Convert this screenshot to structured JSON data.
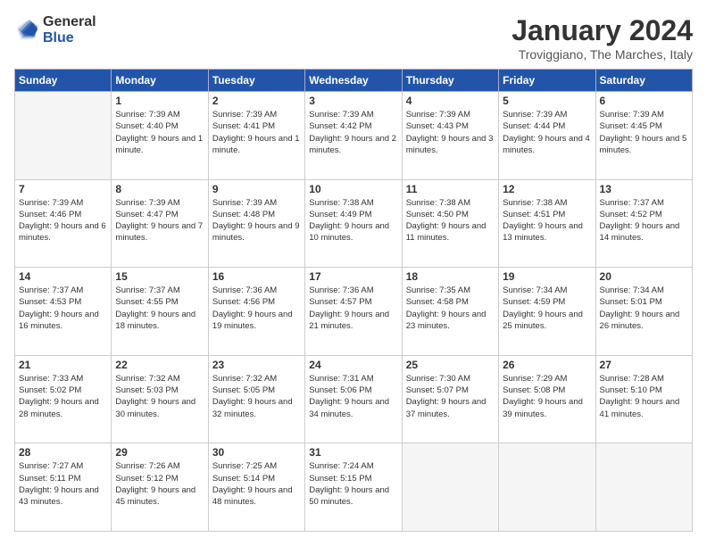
{
  "logo": {
    "general": "General",
    "blue": "Blue"
  },
  "header": {
    "title": "January 2024",
    "subtitle": "Troviggiano, The Marches, Italy"
  },
  "days_of_week": [
    "Sunday",
    "Monday",
    "Tuesday",
    "Wednesday",
    "Thursday",
    "Friday",
    "Saturday"
  ],
  "weeks": [
    [
      {
        "day": "",
        "empty": true
      },
      {
        "day": "1",
        "sunrise": "Sunrise: 7:39 AM",
        "sunset": "Sunset: 4:40 PM",
        "daylight": "Daylight: 9 hours and 1 minute."
      },
      {
        "day": "2",
        "sunrise": "Sunrise: 7:39 AM",
        "sunset": "Sunset: 4:41 PM",
        "daylight": "Daylight: 9 hours and 1 minute."
      },
      {
        "day": "3",
        "sunrise": "Sunrise: 7:39 AM",
        "sunset": "Sunset: 4:42 PM",
        "daylight": "Daylight: 9 hours and 2 minutes."
      },
      {
        "day": "4",
        "sunrise": "Sunrise: 7:39 AM",
        "sunset": "Sunset: 4:43 PM",
        "daylight": "Daylight: 9 hours and 3 minutes."
      },
      {
        "day": "5",
        "sunrise": "Sunrise: 7:39 AM",
        "sunset": "Sunset: 4:44 PM",
        "daylight": "Daylight: 9 hours and 4 minutes."
      },
      {
        "day": "6",
        "sunrise": "Sunrise: 7:39 AM",
        "sunset": "Sunset: 4:45 PM",
        "daylight": "Daylight: 9 hours and 5 minutes."
      }
    ],
    [
      {
        "day": "7",
        "sunrise": "Sunrise: 7:39 AM",
        "sunset": "Sunset: 4:46 PM",
        "daylight": "Daylight: 9 hours and 6 minutes."
      },
      {
        "day": "8",
        "sunrise": "Sunrise: 7:39 AM",
        "sunset": "Sunset: 4:47 PM",
        "daylight": "Daylight: 9 hours and 7 minutes."
      },
      {
        "day": "9",
        "sunrise": "Sunrise: 7:39 AM",
        "sunset": "Sunset: 4:48 PM",
        "daylight": "Daylight: 9 hours and 9 minutes."
      },
      {
        "day": "10",
        "sunrise": "Sunrise: 7:38 AM",
        "sunset": "Sunset: 4:49 PM",
        "daylight": "Daylight: 9 hours and 10 minutes."
      },
      {
        "day": "11",
        "sunrise": "Sunrise: 7:38 AM",
        "sunset": "Sunset: 4:50 PM",
        "daylight": "Daylight: 9 hours and 11 minutes."
      },
      {
        "day": "12",
        "sunrise": "Sunrise: 7:38 AM",
        "sunset": "Sunset: 4:51 PM",
        "daylight": "Daylight: 9 hours and 13 minutes."
      },
      {
        "day": "13",
        "sunrise": "Sunrise: 7:37 AM",
        "sunset": "Sunset: 4:52 PM",
        "daylight": "Daylight: 9 hours and 14 minutes."
      }
    ],
    [
      {
        "day": "14",
        "sunrise": "Sunrise: 7:37 AM",
        "sunset": "Sunset: 4:53 PM",
        "daylight": "Daylight: 9 hours and 16 minutes."
      },
      {
        "day": "15",
        "sunrise": "Sunrise: 7:37 AM",
        "sunset": "Sunset: 4:55 PM",
        "daylight": "Daylight: 9 hours and 18 minutes."
      },
      {
        "day": "16",
        "sunrise": "Sunrise: 7:36 AM",
        "sunset": "Sunset: 4:56 PM",
        "daylight": "Daylight: 9 hours and 19 minutes."
      },
      {
        "day": "17",
        "sunrise": "Sunrise: 7:36 AM",
        "sunset": "Sunset: 4:57 PM",
        "daylight": "Daylight: 9 hours and 21 minutes."
      },
      {
        "day": "18",
        "sunrise": "Sunrise: 7:35 AM",
        "sunset": "Sunset: 4:58 PM",
        "daylight": "Daylight: 9 hours and 23 minutes."
      },
      {
        "day": "19",
        "sunrise": "Sunrise: 7:34 AM",
        "sunset": "Sunset: 4:59 PM",
        "daylight": "Daylight: 9 hours and 25 minutes."
      },
      {
        "day": "20",
        "sunrise": "Sunrise: 7:34 AM",
        "sunset": "Sunset: 5:01 PM",
        "daylight": "Daylight: 9 hours and 26 minutes."
      }
    ],
    [
      {
        "day": "21",
        "sunrise": "Sunrise: 7:33 AM",
        "sunset": "Sunset: 5:02 PM",
        "daylight": "Daylight: 9 hours and 28 minutes."
      },
      {
        "day": "22",
        "sunrise": "Sunrise: 7:32 AM",
        "sunset": "Sunset: 5:03 PM",
        "daylight": "Daylight: 9 hours and 30 minutes."
      },
      {
        "day": "23",
        "sunrise": "Sunrise: 7:32 AM",
        "sunset": "Sunset: 5:05 PM",
        "daylight": "Daylight: 9 hours and 32 minutes."
      },
      {
        "day": "24",
        "sunrise": "Sunrise: 7:31 AM",
        "sunset": "Sunset: 5:06 PM",
        "daylight": "Daylight: 9 hours and 34 minutes."
      },
      {
        "day": "25",
        "sunrise": "Sunrise: 7:30 AM",
        "sunset": "Sunset: 5:07 PM",
        "daylight": "Daylight: 9 hours and 37 minutes."
      },
      {
        "day": "26",
        "sunrise": "Sunrise: 7:29 AM",
        "sunset": "Sunset: 5:08 PM",
        "daylight": "Daylight: 9 hours and 39 minutes."
      },
      {
        "day": "27",
        "sunrise": "Sunrise: 7:28 AM",
        "sunset": "Sunset: 5:10 PM",
        "daylight": "Daylight: 9 hours and 41 minutes."
      }
    ],
    [
      {
        "day": "28",
        "sunrise": "Sunrise: 7:27 AM",
        "sunset": "Sunset: 5:11 PM",
        "daylight": "Daylight: 9 hours and 43 minutes."
      },
      {
        "day": "29",
        "sunrise": "Sunrise: 7:26 AM",
        "sunset": "Sunset: 5:12 PM",
        "daylight": "Daylight: 9 hours and 45 minutes."
      },
      {
        "day": "30",
        "sunrise": "Sunrise: 7:25 AM",
        "sunset": "Sunset: 5:14 PM",
        "daylight": "Daylight: 9 hours and 48 minutes."
      },
      {
        "day": "31",
        "sunrise": "Sunrise: 7:24 AM",
        "sunset": "Sunset: 5:15 PM",
        "daylight": "Daylight: 9 hours and 50 minutes."
      },
      {
        "day": "",
        "empty": true
      },
      {
        "day": "",
        "empty": true
      },
      {
        "day": "",
        "empty": true
      }
    ]
  ]
}
